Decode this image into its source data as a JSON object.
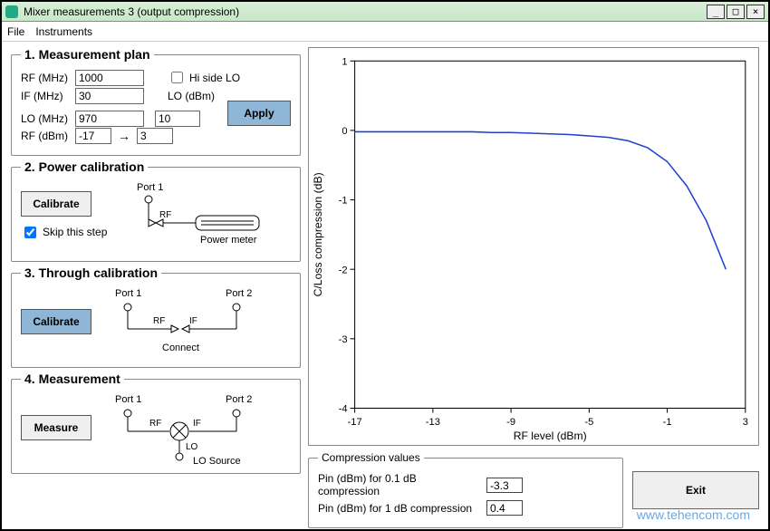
{
  "window": {
    "title": "Mixer measurements 3 (output compression)"
  },
  "menu": {
    "file": "File",
    "instruments": "Instruments"
  },
  "plan": {
    "legend": "1. Measurement plan",
    "rf_mhz_label": "RF (MHz)",
    "rf_mhz": "1000",
    "hi_side": "Hi side LO",
    "if_mhz_label": "IF (MHz)",
    "if_mhz": "30",
    "lo_dbm_label": "LO (dBm)",
    "lo_mhz_label": "LO (MHz)",
    "lo_mhz": "970",
    "lo_dbm": "10",
    "rf_dbm_label": "RF (dBm)",
    "rf_dbm_from": "-17",
    "rf_dbm_to": "3",
    "apply": "Apply"
  },
  "pcal": {
    "legend": "2. Power calibration",
    "btn": "Calibrate",
    "skip": "Skip this step",
    "port1": "Port 1",
    "rf": "RF",
    "pm": "Power meter"
  },
  "tcal": {
    "legend": "3. Through calibration",
    "btn": "Calibrate",
    "port1": "Port 1",
    "port2": "Port 2",
    "rf": "RF",
    "if": "IF",
    "connect": "Connect"
  },
  "meas": {
    "legend": "4. Measurement",
    "btn": "Measure",
    "port1": "Port 1",
    "port2": "Port 2",
    "rf": "RF",
    "if": "IF",
    "lo": "LO",
    "losrc": "LO Source"
  },
  "comp": {
    "legend": "Compression values",
    "l01": "Pin (dBm) for 0.1 dB compression",
    "v01": "-3.3",
    "l1": "Pin (dBm) for 1 dB compression",
    "v1": "0.4"
  },
  "exit": "Exit",
  "watermark": "www.tehencom.com",
  "chart_data": {
    "type": "line",
    "xlabel": "RF level (dBm)",
    "ylabel": "C/Loss compression (dB)",
    "xlim": [
      -17,
      3
    ],
    "ylim": [
      -4,
      1
    ],
    "xticks": [
      -17,
      -13,
      -9,
      -5,
      -1,
      3
    ],
    "yticks": [
      -4,
      -3,
      -2,
      -1,
      0,
      1
    ],
    "x": [
      -17,
      -16,
      -15,
      -14,
      -13,
      -12,
      -11,
      -10,
      -9,
      -8,
      -7,
      -6,
      -5,
      -4,
      -3,
      -2,
      -1,
      0,
      1,
      2
    ],
    "y": [
      -0.02,
      -0.02,
      -0.02,
      -0.02,
      -0.02,
      -0.02,
      -0.02,
      -0.03,
      -0.03,
      -0.04,
      -0.05,
      -0.06,
      -0.08,
      -0.1,
      -0.15,
      -0.25,
      -0.45,
      -0.8,
      -1.3,
      -2.0
    ]
  }
}
